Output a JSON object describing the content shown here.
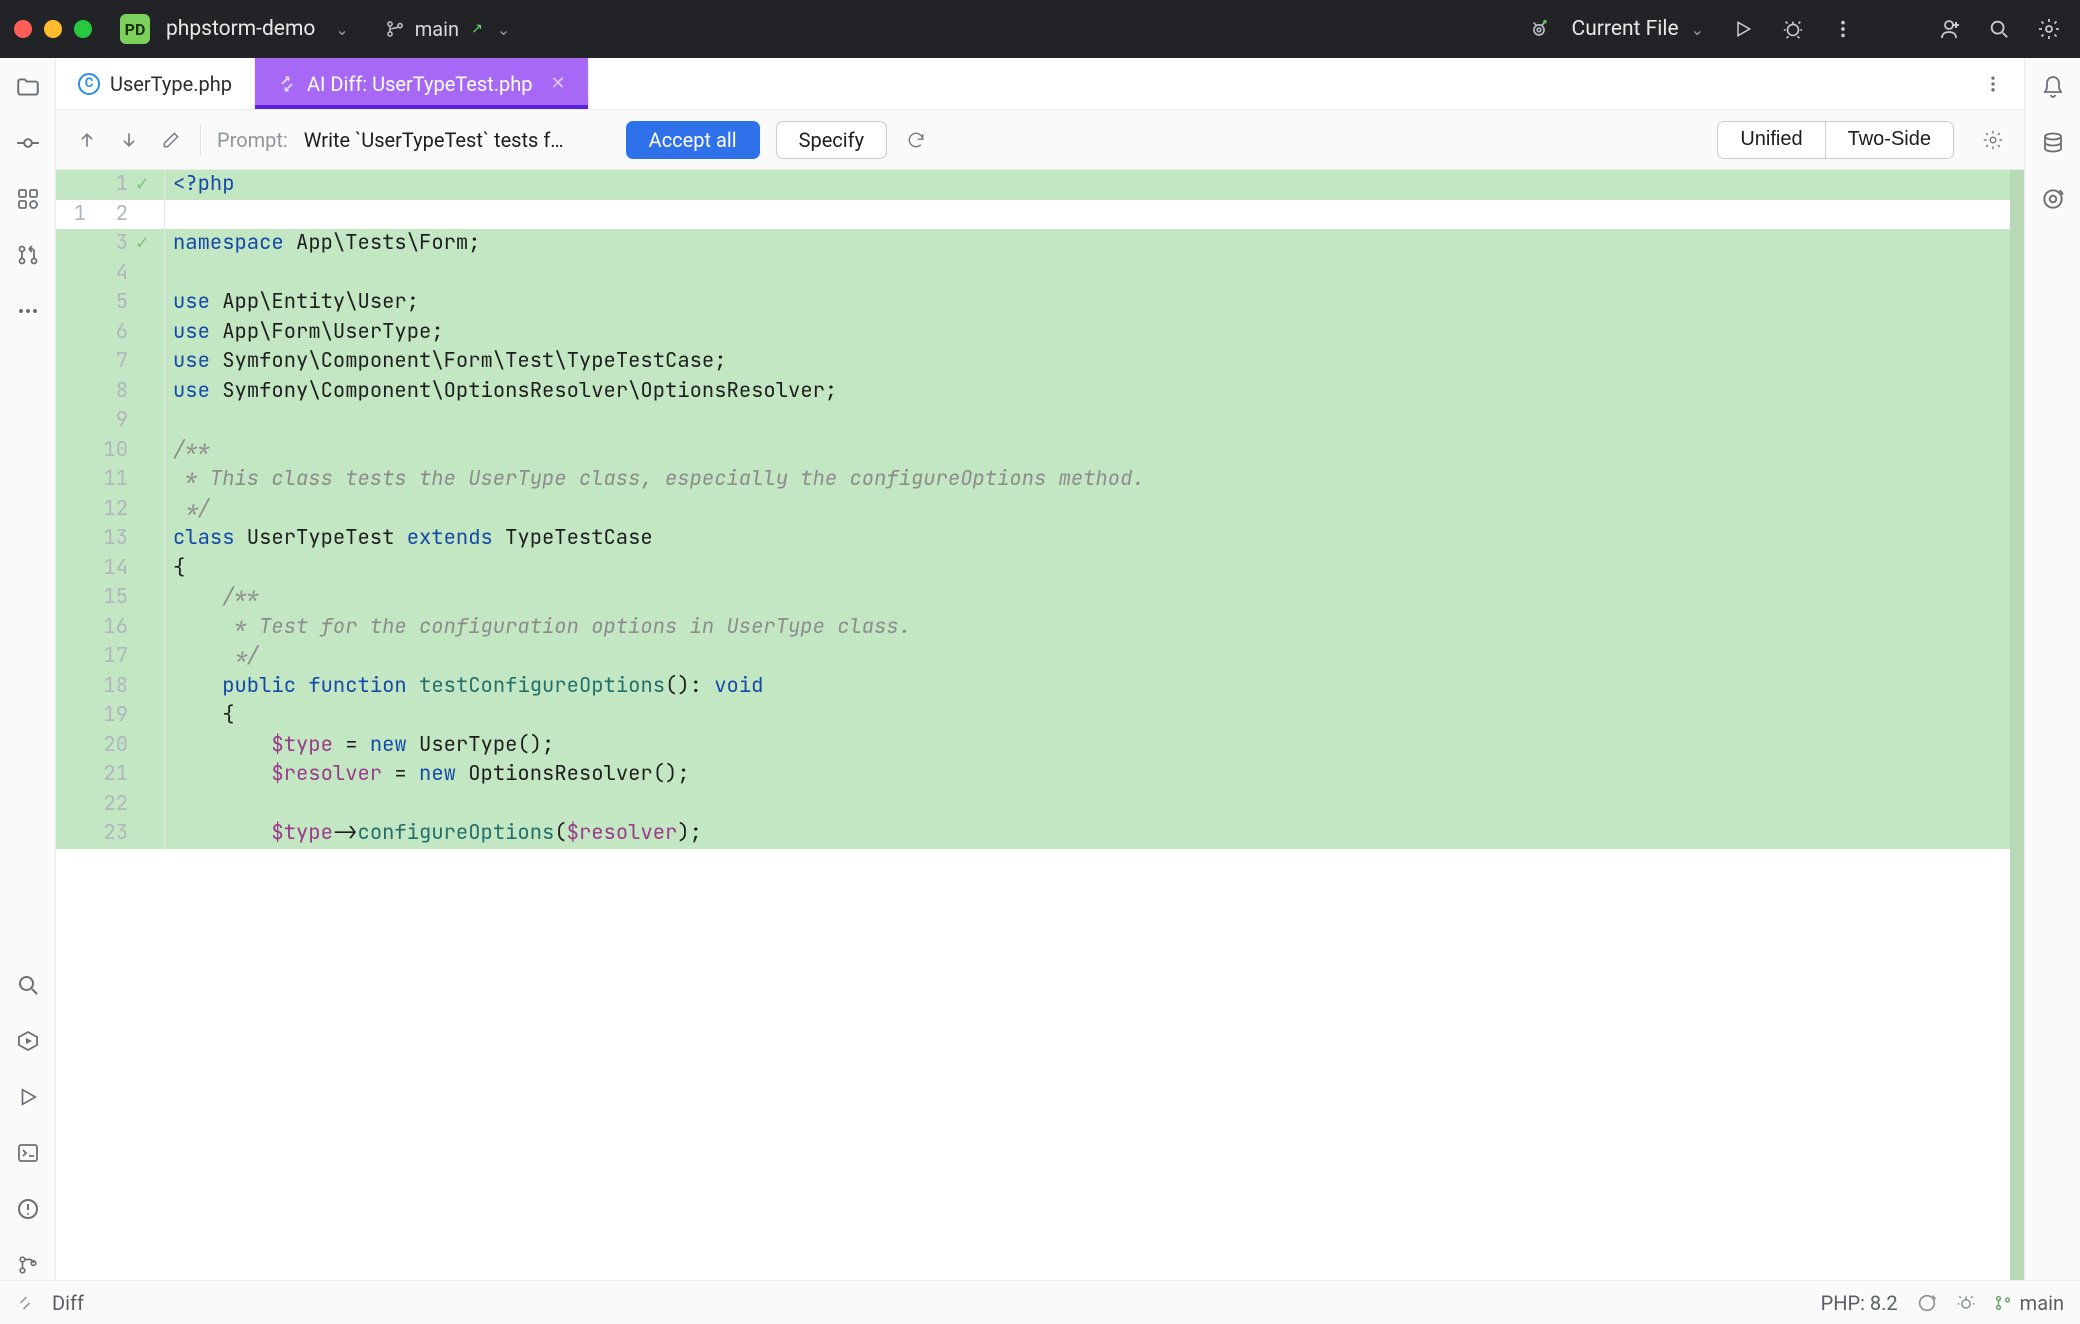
{
  "titlebar": {
    "project_name": "phpstorm-demo",
    "project_badge": "PD",
    "branch": "main",
    "run_config": "Current File"
  },
  "tabs": {
    "user_type": "UserType.php",
    "ai_diff": "AI Diff: UserTypeTest.php"
  },
  "prompt_bar": {
    "label": "Prompt:",
    "text": "Write `UserTypeTest` tests f…",
    "accept": "Accept all",
    "specify": "Specify",
    "seg_unified": "Unified",
    "seg_two_side": "Two-Side"
  },
  "editor": {
    "lines": [
      {
        "l": "",
        "r": "1",
        "m": "✓",
        "added": true,
        "tokens": [
          [
            "kw",
            "<?php"
          ]
        ]
      },
      {
        "l": "1",
        "r": "2",
        "m": "",
        "added": false,
        "tokens": [
          [
            "",
            ""
          ]
        ]
      },
      {
        "l": "",
        "r": "3",
        "m": "✓",
        "added": true,
        "tokens": [
          [
            "kw",
            "namespace"
          ],
          [
            "",
            " "
          ],
          [
            "nsname",
            "App\\Tests\\Form"
          ],
          [
            "",
            ";"
          ]
        ]
      },
      {
        "l": "",
        "r": "4",
        "m": "",
        "added": true,
        "tokens": [
          [
            "",
            ""
          ]
        ]
      },
      {
        "l": "",
        "r": "5",
        "m": "",
        "added": true,
        "tokens": [
          [
            "kw",
            "use"
          ],
          [
            "",
            " "
          ],
          [
            "nsname",
            "App\\Entity\\User"
          ],
          [
            "",
            ";"
          ]
        ]
      },
      {
        "l": "",
        "r": "6",
        "m": "",
        "added": true,
        "tokens": [
          [
            "kw",
            "use"
          ],
          [
            "",
            " "
          ],
          [
            "nsname",
            "App\\Form\\UserType"
          ],
          [
            "",
            ";"
          ]
        ]
      },
      {
        "l": "",
        "r": "7",
        "m": "",
        "added": true,
        "tokens": [
          [
            "kw",
            "use"
          ],
          [
            "",
            " "
          ],
          [
            "nsname",
            "Symfony\\Component\\Form\\Test\\TypeTestCase"
          ],
          [
            "",
            ";"
          ]
        ]
      },
      {
        "l": "",
        "r": "8",
        "m": "",
        "added": true,
        "tokens": [
          [
            "kw",
            "use"
          ],
          [
            "",
            " "
          ],
          [
            "nsname",
            "Symfony\\Component\\OptionsResolver\\OptionsResolver"
          ],
          [
            "",
            ";"
          ]
        ]
      },
      {
        "l": "",
        "r": "9",
        "m": "",
        "added": true,
        "tokens": [
          [
            "",
            ""
          ]
        ]
      },
      {
        "l": "",
        "r": "10",
        "m": "",
        "added": true,
        "tokens": [
          [
            "comment",
            "/**"
          ]
        ]
      },
      {
        "l": "",
        "r": "11",
        "m": "",
        "added": true,
        "tokens": [
          [
            "comment",
            " * This class tests the UserType class, especially the configureOptions method."
          ]
        ]
      },
      {
        "l": "",
        "r": "12",
        "m": "",
        "added": true,
        "tokens": [
          [
            "comment",
            " */"
          ]
        ]
      },
      {
        "l": "",
        "r": "13",
        "m": "",
        "added": true,
        "tokens": [
          [
            "kw",
            "class"
          ],
          [
            "",
            " UserTypeTest "
          ],
          [
            "kw",
            "extends"
          ],
          [
            "",
            " TypeTestCase"
          ]
        ]
      },
      {
        "l": "",
        "r": "14",
        "m": "",
        "added": true,
        "tokens": [
          [
            "",
            "{"
          ]
        ]
      },
      {
        "l": "",
        "r": "15",
        "m": "",
        "added": true,
        "tokens": [
          [
            "",
            "    "
          ],
          [
            "comment",
            "/**"
          ]
        ]
      },
      {
        "l": "",
        "r": "16",
        "m": "",
        "added": true,
        "tokens": [
          [
            "",
            "    "
          ],
          [
            "comment",
            " * Test for the configuration options in UserType class."
          ]
        ]
      },
      {
        "l": "",
        "r": "17",
        "m": "",
        "added": true,
        "tokens": [
          [
            "",
            "    "
          ],
          [
            "comment",
            " */"
          ]
        ]
      },
      {
        "l": "",
        "r": "18",
        "m": "",
        "added": true,
        "tokens": [
          [
            "",
            "    "
          ],
          [
            "kw",
            "public"
          ],
          [
            "",
            " "
          ],
          [
            "kw",
            "function"
          ],
          [
            "",
            " "
          ],
          [
            "func",
            "testConfigureOptions"
          ],
          [
            "",
            "(): "
          ],
          [
            "kw",
            "void"
          ]
        ]
      },
      {
        "l": "",
        "r": "19",
        "m": "",
        "added": true,
        "tokens": [
          [
            "",
            "    {"
          ]
        ]
      },
      {
        "l": "",
        "r": "20",
        "m": "",
        "added": true,
        "tokens": [
          [
            "",
            "        "
          ],
          [
            "var",
            "$type"
          ],
          [
            "",
            " = "
          ],
          [
            "kw",
            "new"
          ],
          [
            "",
            " UserType();"
          ]
        ]
      },
      {
        "l": "",
        "r": "21",
        "m": "",
        "added": true,
        "tokens": [
          [
            "",
            "        "
          ],
          [
            "var",
            "$resolver"
          ],
          [
            "",
            " = "
          ],
          [
            "kw",
            "new"
          ],
          [
            "",
            " OptionsResolver();"
          ]
        ]
      },
      {
        "l": "",
        "r": "22",
        "m": "",
        "added": true,
        "tokens": [
          [
            "",
            ""
          ]
        ]
      },
      {
        "l": "",
        "r": "23",
        "m": "",
        "added": true,
        "tokens": [
          [
            "",
            "        "
          ],
          [
            "var",
            "$type"
          ],
          [
            "",
            "->"
          ],
          [
            "func",
            "configureOptions"
          ],
          [
            "",
            "("
          ],
          [
            "var",
            "$resolver"
          ],
          [
            "",
            ");"
          ]
        ]
      }
    ]
  },
  "statusbar": {
    "diff": "Diff",
    "php": "PHP: 8.2",
    "branch": "main"
  }
}
